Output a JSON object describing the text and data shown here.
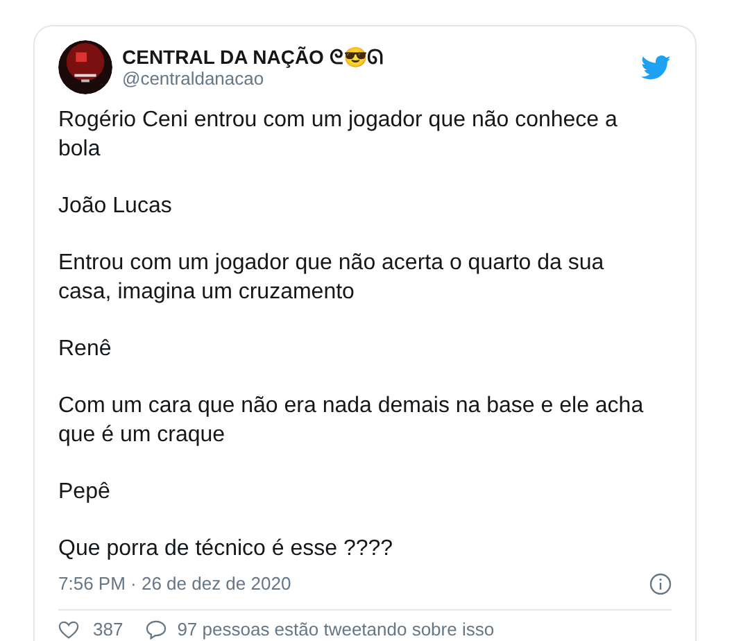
{
  "author": {
    "name": "CENTRAL DA NAÇÃO ᘓ😎ᘏ",
    "handle": "@centraldanacao"
  },
  "paragraphs": [
    "Rogério Ceni entrou com um jogador que não conhece a bola",
    "João Lucas",
    "Entrou com um jogador que não acerta o quarto da sua casa, imagina um cruzamento",
    "Renê",
    "Com um cara que não era nada demais na base e ele acha que é um craque",
    "Pepê",
    "Que porra de técnico é esse ????"
  ],
  "timestamp": "7:56 PM · 26 de dez de 2020",
  "likes": "387",
  "talking": "97 pessoas estão tweetando sobre isso"
}
